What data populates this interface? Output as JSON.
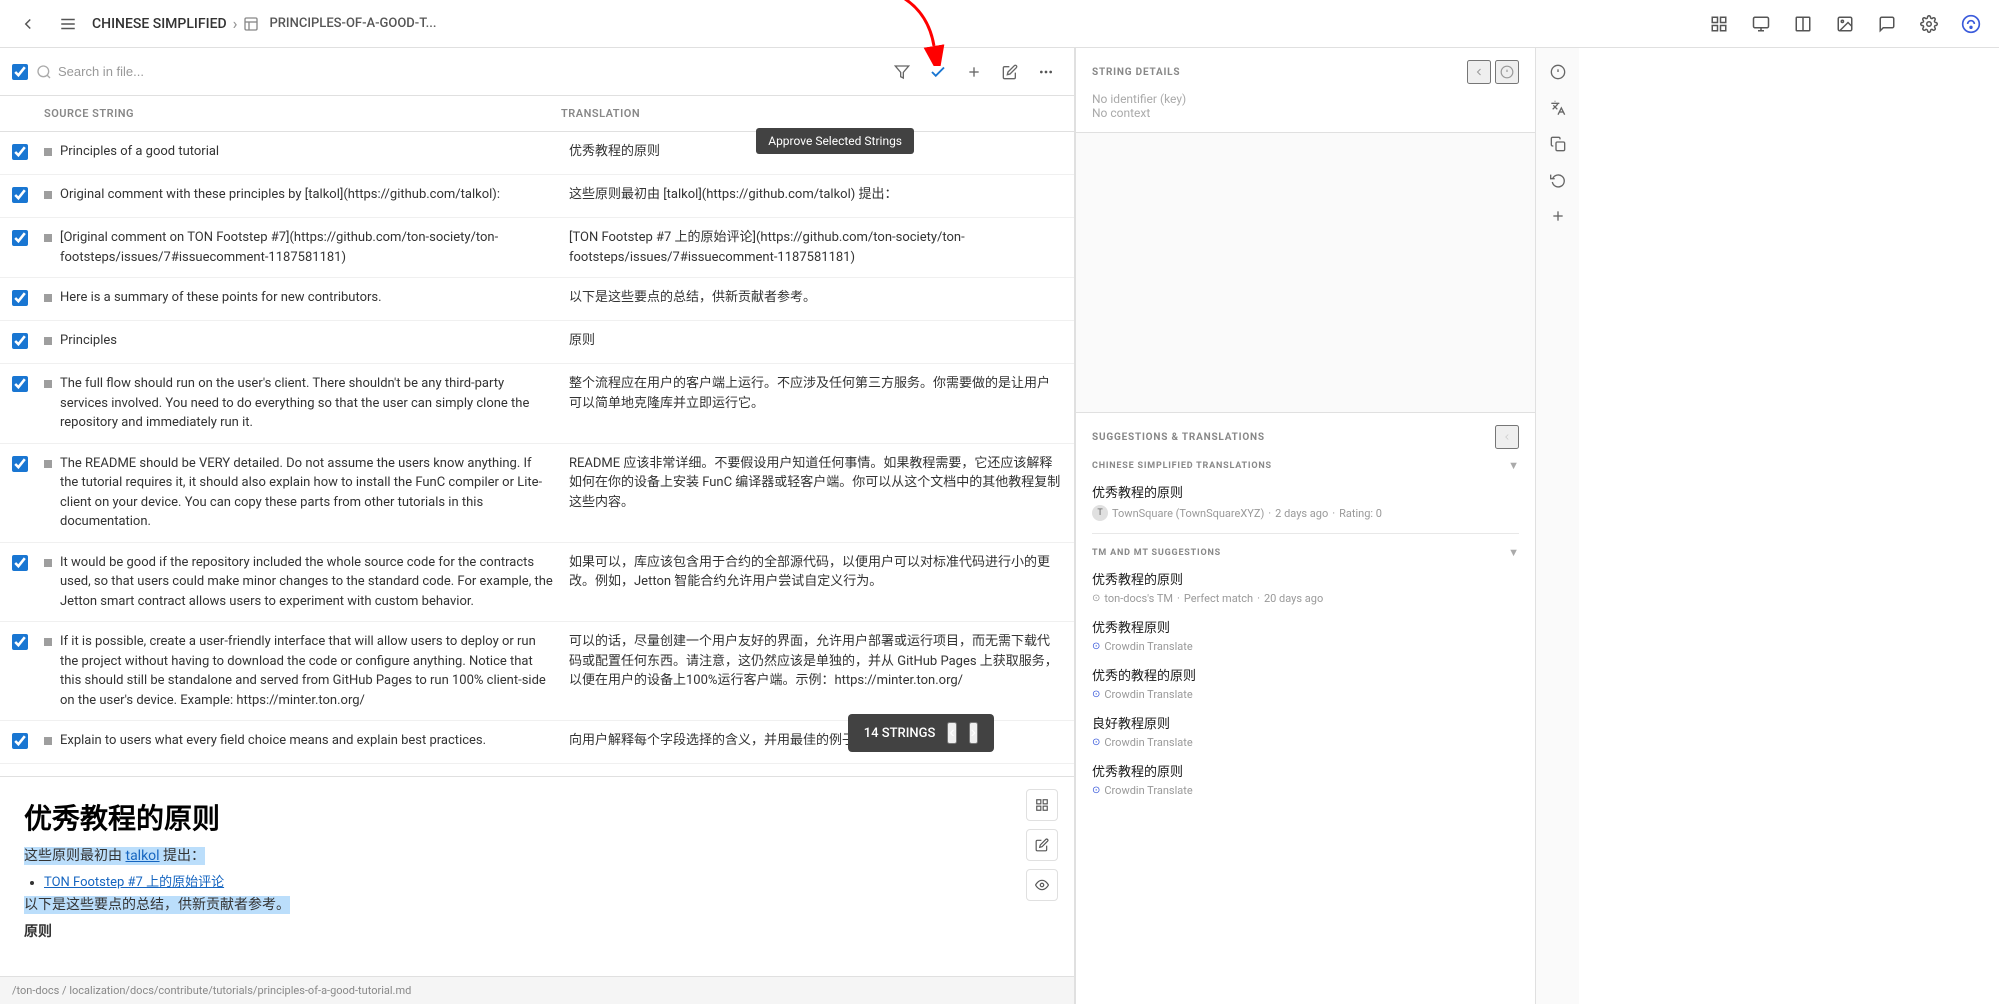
{
  "topbar": {
    "back_icon": "←",
    "menu_icon": "☰",
    "title": "CHINESE SIMPLIFIED",
    "sep": "›",
    "file": "PRINCIPLES-OF-A-GOOD-T...",
    "icons": [
      "grid",
      "monitor",
      "columns",
      "picture",
      "chat",
      "gear",
      "crowdin"
    ]
  },
  "search": {
    "placeholder": "Search in file...",
    "filter_icon": "filter"
  },
  "toolbar": {
    "approve_icon": "✓",
    "add_icon": "+",
    "edit_icon": "✎",
    "more_icon": "⋮",
    "approve_tooltip": "Approve Selected Strings"
  },
  "table_header": {
    "source_label": "SOURCE STRING",
    "translation_label": "TRANSLATION"
  },
  "strings": [
    {
      "id": 1,
      "checked": true,
      "status": "grey",
      "source": "Principles of a good tutorial",
      "translation": "优秀教程的原则"
    },
    {
      "id": 2,
      "checked": true,
      "status": "grey",
      "source": "Original comment with these principles by [talkol](https://github.com/talkol):",
      "translation": "这些原则最初由 [talkol](https://github.com/talkol) 提出："
    },
    {
      "id": 3,
      "checked": true,
      "status": "grey",
      "source": "[Original comment on TON Footstep #7](https://github.com/ton-society/ton-footsteps/issues/7#issuecomment-1187581181)",
      "translation": "[TON Footstep #7 上的原始评论](https://github.com/ton-society/ton-footsteps/issues/7#issuecomment-1187581181)"
    },
    {
      "id": 4,
      "checked": true,
      "status": "grey",
      "source": "Here is a summary of these points for new contributors.",
      "translation": "以下是这些要点的总结，供新贡献者参考。"
    },
    {
      "id": 5,
      "checked": true,
      "status": "grey",
      "source": "Principles",
      "translation": "原则"
    },
    {
      "id": 6,
      "checked": true,
      "status": "grey",
      "source": "The full flow should run on the user's client. There shouldn't be any third-party services involved. You need to do everything so that the user can simply clone the repository and immediately run it.",
      "translation": "整个流程应在用户的客户端上运行。不应涉及任何第三方服务。你需要做的是让用户可以简单地克隆库并立即运行它。"
    },
    {
      "id": 7,
      "checked": true,
      "status": "grey",
      "source": "The README should be VERY detailed. Do not assume the users know anything. If the tutorial requires it, it should also explain how to install the FunC compiler or Lite-client on your device. You can copy these parts from other tutorials in this documentation.",
      "translation": "README 应该非常详细。不要假设用户知道任何事情。如果教程需要，它还应该解释如何在你的设备上安装 FunC 编译器或轻客户端。你可以从这个文档中的其他教程复制这些内容。"
    },
    {
      "id": 8,
      "checked": true,
      "status": "grey",
      "source": "It would be good if the repository included the whole source code for the contracts used, so that users could make minor changes to the standard code. For example, the Jetton smart contract allows users to experiment with custom behavior.",
      "translation": "如果可以，库应该包含用于合约的全部源代码，以便用户可以对标准代码进行小的更改。例如，Jetton 智能合约允许用户尝试自定义行为。"
    },
    {
      "id": 9,
      "checked": true,
      "status": "grey",
      "source": "If it is possible, create a user-friendly interface that will allow users to deploy or run the project without having to download the code or configure anything. Notice that this should still be standalone and served from GitHub Pages to run 100% client-side on the user's device. Example: https://minter.ton.org/",
      "translation": "可以的话，尽量创建一个用户友好的界面，允许用户部署或运行项目，而无需下载代码或配置任何东西。请注意，这仍然应该是单独的，并从 GitHub Pages 上获取服务，以便在用户的设备上100%运行客户端。示例：https://minter.ton.org/"
    },
    {
      "id": 10,
      "checked": true,
      "status": "grey",
      "source": "Explain to users what every field choice means and explain best practices.",
      "translation": "向用户解释每个字段选择的含义，并用最佳的例子来进行解释"
    }
  ],
  "strings_badge": {
    "count": "14 STRINGS",
    "prev": "‹",
    "next": "›"
  },
  "preview": {
    "title": "优秀教程的原则",
    "line1": "这些原则最初由",
    "line1_link": "talkol",
    "line1_end": "提出：",
    "line2_link": "TON Footstep #7 上的原始评论",
    "line3": "以下是这些要点的总结，供新贡献者参考。",
    "line4": "原则"
  },
  "file_path": "/ton-docs / localization/docs/contribute/tutorials/principles-of-a-good-tutorial.md",
  "string_details": {
    "panel_title": "STRING DETAILS",
    "no_identifier": "No identifier (key)",
    "no_context": "No context"
  },
  "suggestions": {
    "panel_title": "SUGGESTIONS & TRANSLATIONS",
    "cs_section_title": "CHINESE SIMPLIFIED TRANSLATIONS",
    "cs_toggle": "▼",
    "items": [
      {
        "text": "优秀教程的原则",
        "source": "TownSquare (TownSquareXYZ)",
        "time": "2 days ago",
        "rating": "Rating: 0"
      }
    ],
    "tm_section_title": "TM AND MT SUGGESTIONS",
    "tm_toggle": "▼",
    "tm_items": [
      {
        "text": "优秀教程的原则",
        "source": "ton-docs's TM",
        "match": "Perfect match",
        "time": "20 days ago"
      },
      {
        "text": "优秀教程原则",
        "source": "Crowdin Translate",
        "icon": "crowdin"
      },
      {
        "text": "优秀的教程的原则",
        "source": "Crowdin Translate",
        "icon": "crowdin"
      },
      {
        "text": "良好教程原则",
        "source": "Crowdin Translate",
        "icon": "crowdin"
      },
      {
        "text": "优秀教程的原则",
        "source": "Crowdin Translate",
        "icon": "crowdin"
      }
    ]
  },
  "right_sidebar_icons": [
    "info-icon",
    "translate-icon",
    "copy-icon",
    "history-icon",
    "add-icon"
  ]
}
